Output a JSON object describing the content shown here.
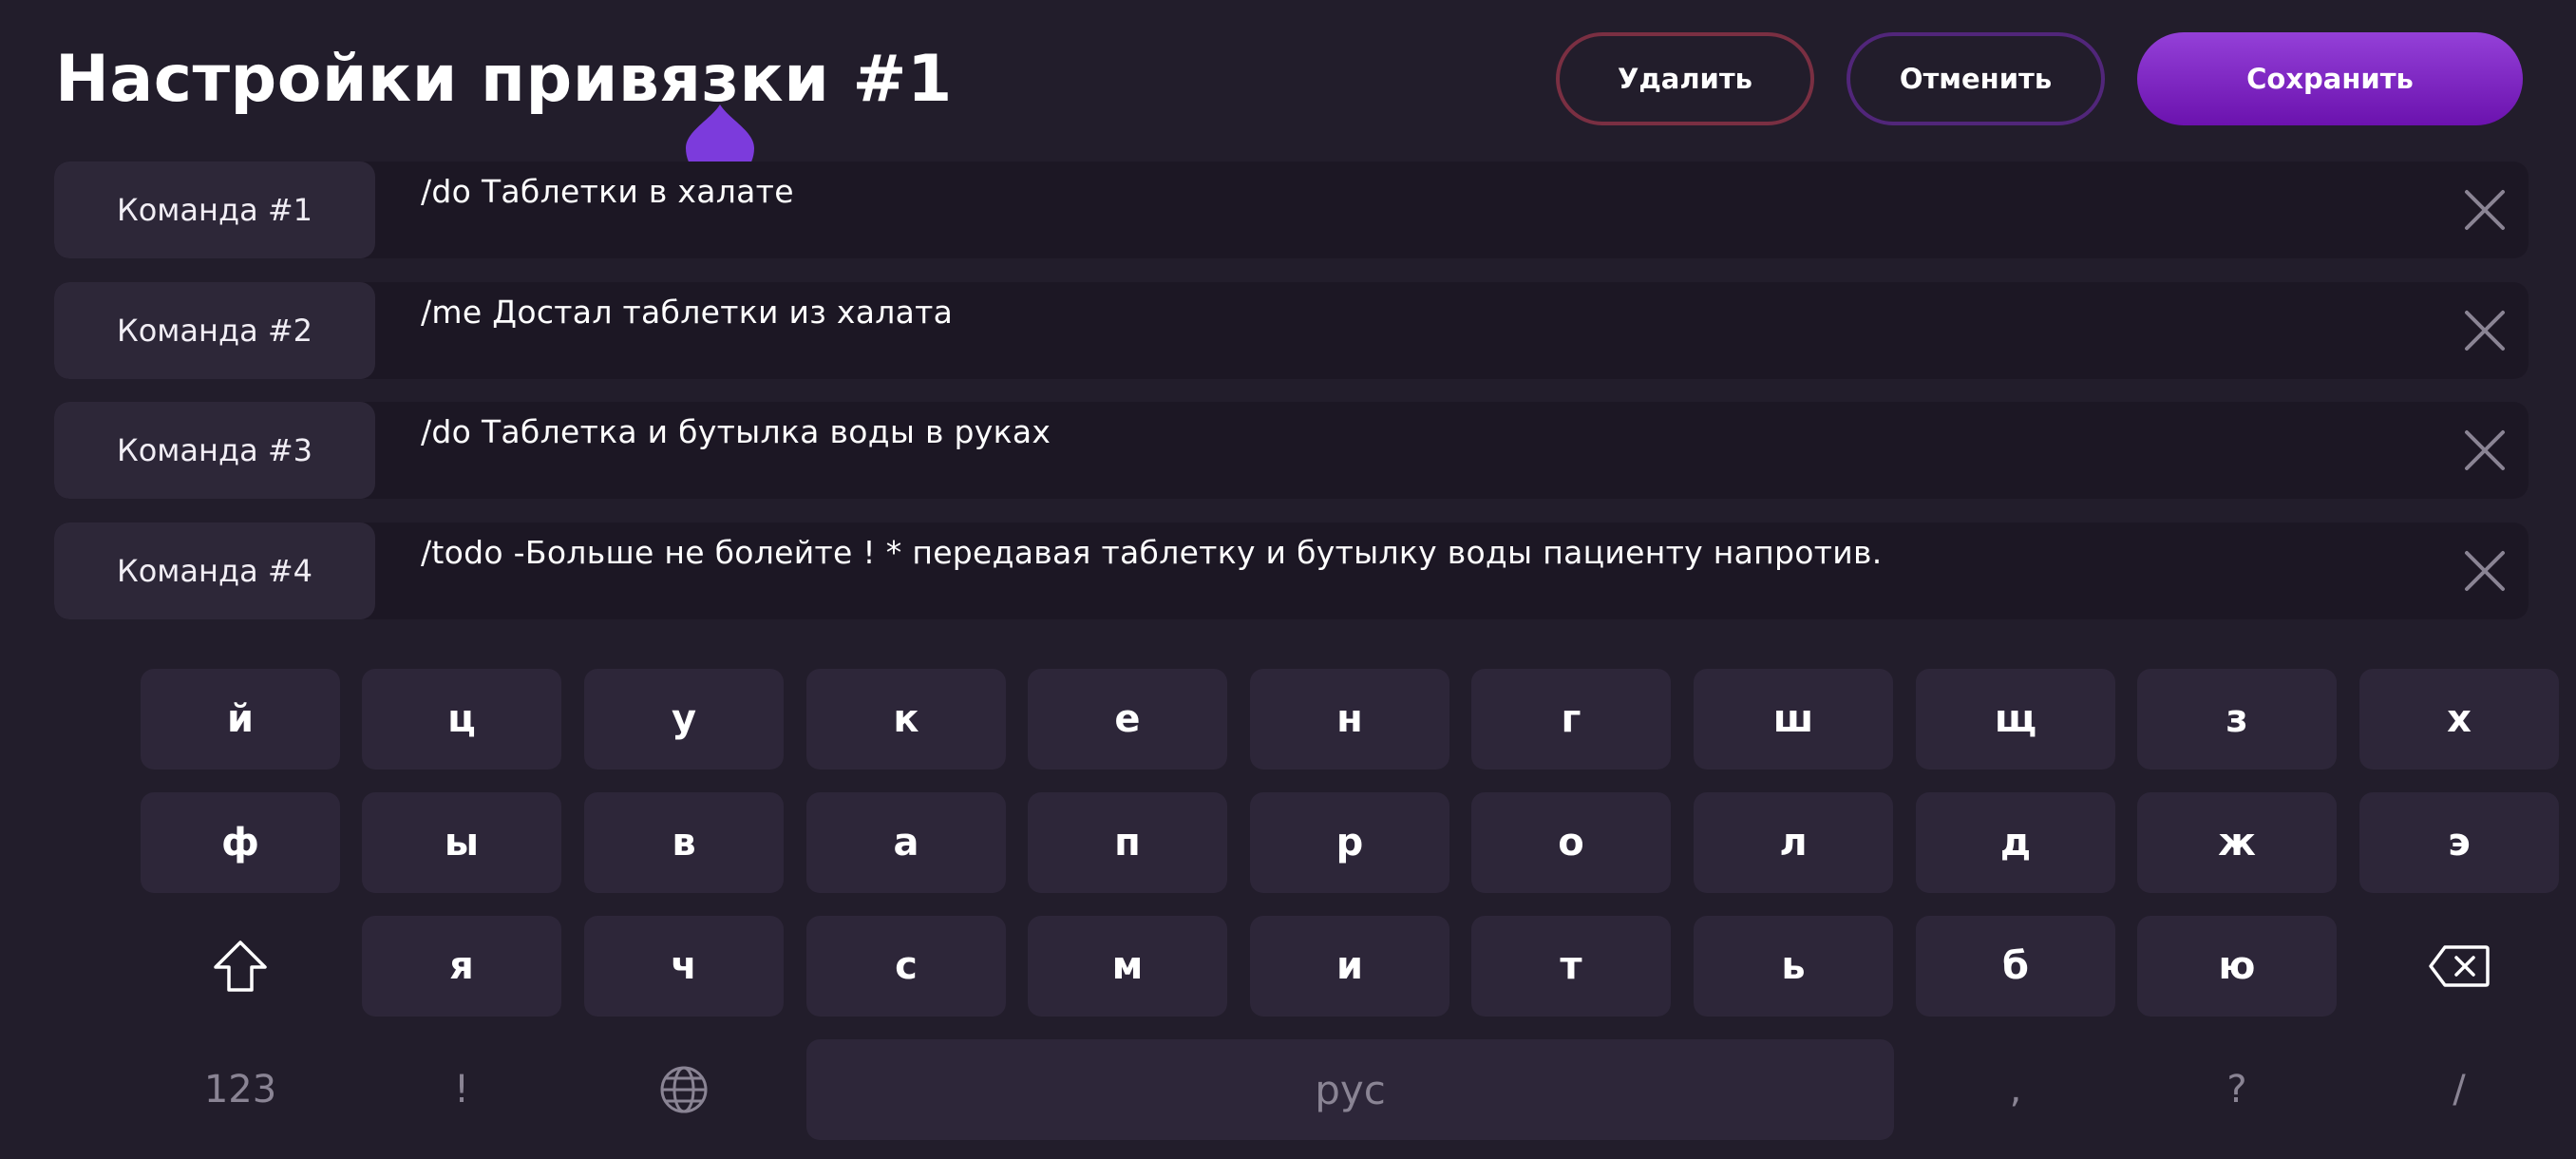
{
  "header": {
    "title": "Настройки привязки #1",
    "delete_label": "Удалить",
    "cancel_label": "Отменить",
    "save_label": "Сохранить"
  },
  "commands": [
    {
      "label": "Команда #1",
      "text": "/do Таблетки в халате"
    },
    {
      "label": "Команда #2",
      "text": "/me Достал  таблетки из халата"
    },
    {
      "label": "Команда #3",
      "text": "/do Таблетка и бутылка воды в руках"
    },
    {
      "label": "Команда #4",
      "text": "/todo -Больше не болейте ! * передавая таблетку и бутылку воды пациенту напротив."
    }
  ],
  "keyboard": {
    "row1": [
      "й",
      "ц",
      "у",
      "к",
      "е",
      "н",
      "г",
      "ш",
      "щ",
      "з",
      "х"
    ],
    "row2": [
      "ф",
      "ы",
      "в",
      "а",
      "п",
      "р",
      "о",
      "л",
      "д",
      "ж",
      "э"
    ],
    "row3": [
      "я",
      "ч",
      "с",
      "м",
      "и",
      "т",
      "ь",
      "б",
      "ю"
    ],
    "shift_icon": "shift-icon",
    "backspace_icon": "backspace-icon",
    "numbers_label": "123",
    "exclaim_label": "!",
    "globe_icon": "globe-icon",
    "space_label": "рус",
    "comma_label": ",",
    "question_label": "?",
    "slash_label": "/"
  },
  "colors": {
    "background": "#221d2b",
    "accent": "#8a3fd0",
    "delete_border": "#7a2f42",
    "cancel_border": "#51267a",
    "key": "#2d2639"
  }
}
